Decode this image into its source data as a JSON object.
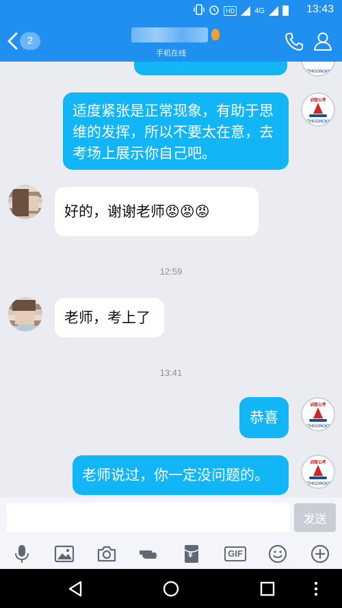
{
  "status_bar": {
    "time": "13:43",
    "network": "4G",
    "hd_label": "HD"
  },
  "header": {
    "back_badge": "2",
    "contact_status": "手机在线"
  },
  "messages": [
    {
      "direction": "out",
      "text": "适度紧张是正常现象，有助于思维的发挥，所以不要太在意，去考场上展示你自己吧。"
    },
    {
      "direction": "in",
      "text": "好的，谢谢老师😡😡😡"
    },
    {
      "type": "timestamp",
      "text": "12:59"
    },
    {
      "direction": "in",
      "text": "老师，考上了"
    },
    {
      "type": "timestamp",
      "text": "13:41"
    },
    {
      "direction": "out",
      "text": "恭喜"
    },
    {
      "direction": "out",
      "text": "老师说过，你一定没问题的。"
    }
  ],
  "teacher_avatar": {
    "top_text": "启智公考",
    "bottom_text": "QIZHIGONGKAO"
  },
  "composer": {
    "input_value": "",
    "send_label": "发送"
  },
  "toolbar": {
    "icons": [
      "microphone-icon",
      "image-icon",
      "camera-icon",
      "poke-icon",
      "red-packet-icon",
      "gif-icon",
      "emoji-icon",
      "plus-icon"
    ],
    "gif_label": "GIF",
    "red_packet_label": "¥"
  },
  "colors": {
    "brand_blue": "#1f8ff0",
    "outgoing_bubble": "#12b6f7",
    "incoming_bubble": "#ffffff",
    "chat_background": "#ebecf1"
  }
}
